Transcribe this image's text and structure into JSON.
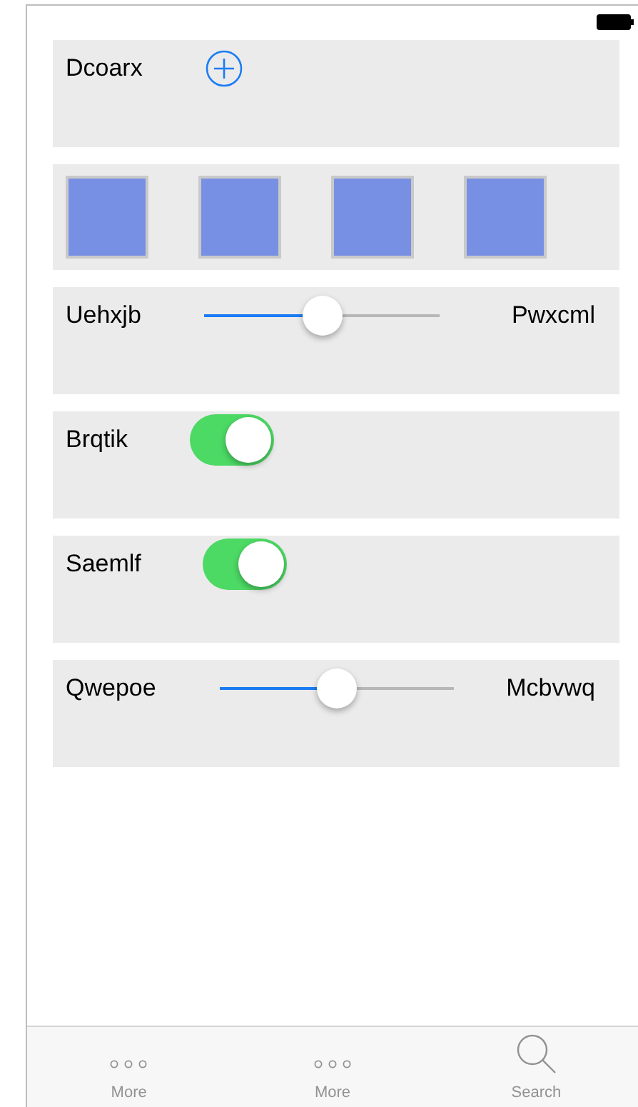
{
  "rows": [
    {
      "kind": "button",
      "label": "Dcoarx"
    },
    {
      "kind": "images"
    },
    {
      "kind": "slider",
      "label": "Uehxjb",
      "level": 0.5,
      "value_label": "Pwxcml"
    },
    {
      "kind": "switch",
      "label": "Brqtik",
      "on": true
    },
    {
      "kind": "switch",
      "label": "Saemlf",
      "on": true
    },
    {
      "kind": "slider",
      "label": "Qwepoe",
      "level": 0.5,
      "value_label": "Mcbvwq"
    }
  ],
  "tab_bar": [
    {
      "kind": "more",
      "label": "More",
      "selected": false
    },
    {
      "kind": "more",
      "label": "More",
      "selected": false
    },
    {
      "kind": "search",
      "label": "Search",
      "selected": false
    }
  ]
}
